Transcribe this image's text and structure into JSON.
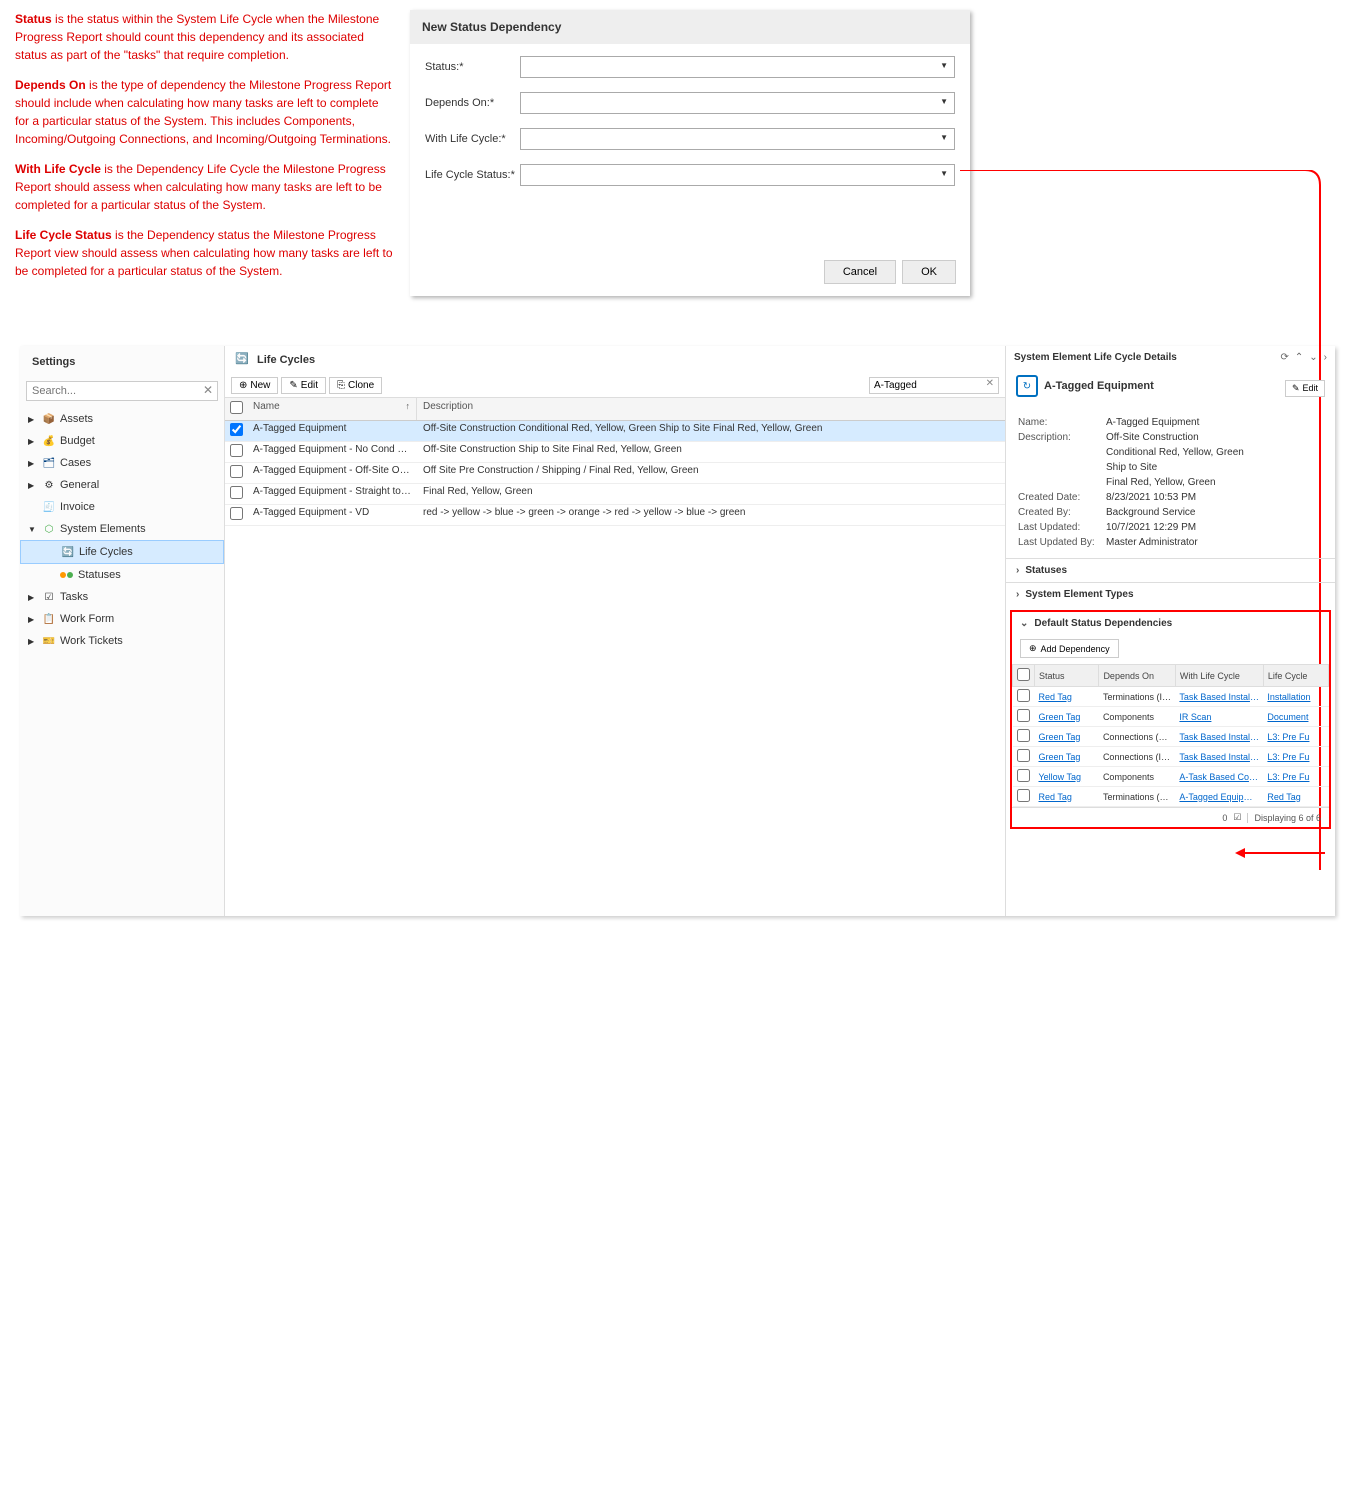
{
  "help": {
    "status_bold": "Status",
    "status_text": " is the status within the System Life Cycle when the Milestone Progress Report should count this dependency and its associated status as part of the \"tasks\" that require completion.",
    "depends_bold": "Depends On",
    "depends_text": " is the type of dependency the Milestone Progress Report should include when calculating how many tasks are left to complete for a particular status of the System. This includes Components, Incoming/Outgoing Connections, and Incoming/Outgoing Terminations.",
    "withlc_bold": "With Life Cycle",
    "withlc_text": " is the Dependency Life Cycle the Milestone Progress Report should assess when calculating how many tasks are left to be completed for a particular status of the System.",
    "lcs_bold": "Life Cycle Status",
    "lcs_text": " is the Dependency status the Milestone Progress Report view should assess when calculating how many tasks are left to be completed for a particular status of the System."
  },
  "dialog": {
    "title": "New Status Dependency",
    "labels": {
      "status": "Status:*",
      "depends": "Depends On:*",
      "withlc": "With Life Cycle:*",
      "lcs": "Life Cycle Status:*"
    },
    "cancel": "Cancel",
    "ok": "OK"
  },
  "sidebar": {
    "title": "Settings",
    "search_placeholder": "Search...",
    "items": [
      {
        "label": "Assets"
      },
      {
        "label": "Budget"
      },
      {
        "label": "Cases"
      },
      {
        "label": "General"
      },
      {
        "label": "Invoice"
      },
      {
        "label": "System Elements"
      },
      {
        "label": "Life Cycles"
      },
      {
        "label": "Statuses"
      },
      {
        "label": "Tasks"
      },
      {
        "label": "Work Form"
      },
      {
        "label": "Work Tickets"
      }
    ]
  },
  "mid": {
    "title": "Life Cycles",
    "toolbar": {
      "new": "New",
      "edit": "Edit",
      "clone": "Clone"
    },
    "filter_value": "A-Tagged",
    "cols": {
      "name": "Name",
      "desc": "Description"
    },
    "rows": [
      {
        "name": "A-Tagged Equipment",
        "desc": "Off-Site Construction Conditional Red, Yellow, Green Ship to Site Final Red, Yellow, Green",
        "sel": true
      },
      {
        "name": "A-Tagged Equipment - No Cond Tag",
        "desc": "Off-Site Construction Ship to Site Final Red, Yellow, Green"
      },
      {
        "name": "A-Tagged Equipment - Off-Site Ord...",
        "desc": "Off Site Pre Construction / Shipping / Final Red, Yellow, Green"
      },
      {
        "name": "A-Tagged Equipment - Straight to Site",
        "desc": "Final Red, Yellow, Green"
      },
      {
        "name": "A-Tagged Equipment - VD",
        "desc": "red -> yellow -> blue -> green -> orange -> red -> yellow -> blue -> green"
      }
    ]
  },
  "details": {
    "title": "System Element Life Cycle Details",
    "entity": "A-Tagged Equipment",
    "edit": "Edit",
    "props": [
      {
        "label": "Name:",
        "value": "A-Tagged Equipment"
      },
      {
        "label": "Description:",
        "value": "Off-Site Construction"
      },
      {
        "label": "",
        "value": "Conditional Red, Yellow, Green"
      },
      {
        "label": "",
        "value": "Ship to Site"
      },
      {
        "label": "",
        "value": "Final Red, Yellow, Green"
      },
      {
        "label": "Created Date:",
        "value": "8/23/2021 10:53 PM"
      },
      {
        "label": "Created By:",
        "value": "Background Service"
      },
      {
        "label": "Last Updated:",
        "value": "10/7/2021 12:29 PM"
      },
      {
        "label": "Last Updated By:",
        "value": "Master Administrator"
      }
    ],
    "acc_statuses": "Statuses",
    "acc_types": "System Element Types",
    "dep": {
      "title": "Default Status Dependencies",
      "add": "Add Dependency",
      "cols": {
        "status": "Status",
        "dep": "Depends On",
        "wlc": "With Life Cycle",
        "lcs": "Life Cycle"
      },
      "rows": [
        {
          "status": "Red Tag",
          "dep": "Terminations (Inco...",
          "wlc": "Task Based Install -...",
          "lcs": "Installation"
        },
        {
          "status": "Green Tag",
          "dep": "Components",
          "wlc": "IR Scan",
          "lcs": "Document"
        },
        {
          "status": "Green Tag",
          "dep": "Connections (Outg...",
          "wlc": "Task Based Install ...",
          "lcs": "L3: Pre Fu"
        },
        {
          "status": "Green Tag",
          "dep": "Connections (Inco...",
          "wlc": "Task Based Install ...",
          "lcs": "L3: Pre Fu"
        },
        {
          "status": "Yellow Tag",
          "dep": "Components",
          "wlc": "A-Task Based Com...",
          "lcs": "L3: Pre Fu"
        },
        {
          "status": "Red Tag",
          "dep": "Terminations (Outg...",
          "wlc": "A-Tagged Equipment",
          "lcs": "Red Tag"
        }
      ],
      "footer_count": "0",
      "footer_text": "Displaying 6 of 6"
    }
  }
}
